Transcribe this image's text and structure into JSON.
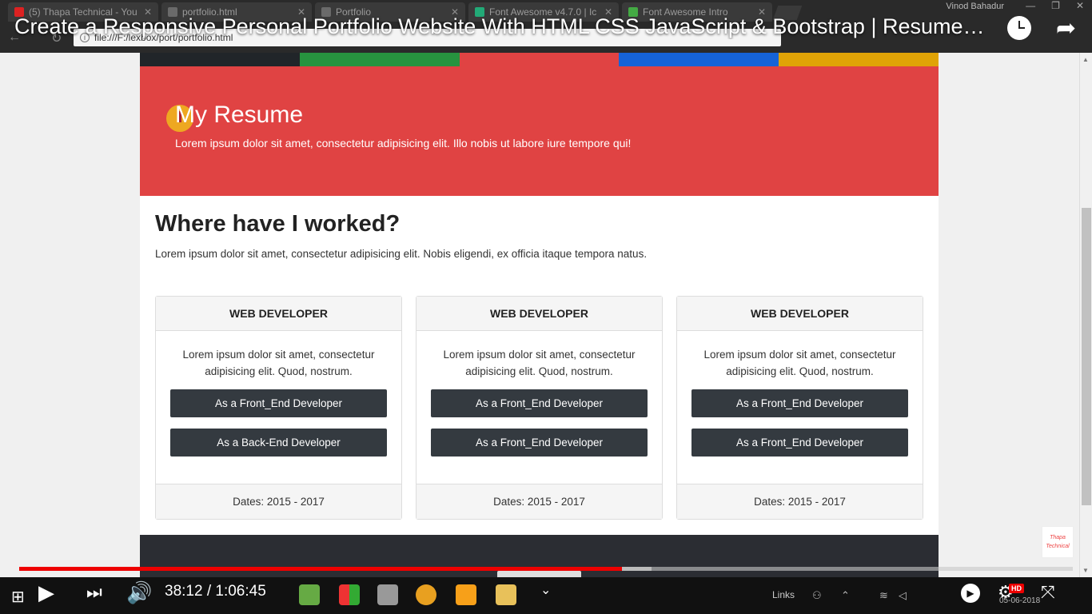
{
  "browser": {
    "tabs": [
      {
        "title": "(5) Thapa Technical - You"
      },
      {
        "title": "portfolio.html"
      },
      {
        "title": "Portfolio"
      },
      {
        "title": "Font Awesome v4.7.0 | Ic"
      },
      {
        "title": "Font Awesome Intro"
      }
    ],
    "user": "Vinod Bahadur",
    "url": "file:///F:/lexbox/port/portfolio.html"
  },
  "video": {
    "title": "Create a Responsive Personal Portfolio Website With HTML CSS JavaScript & Bootstrap | Resume Website",
    "current_time": "38:12",
    "duration": "1:06:45",
    "progress": 0.572,
    "hd_label": "HD"
  },
  "page": {
    "stripe_colors": [
      "#212529",
      "#27933f",
      "#e04343",
      "#1663d8",
      "#e0a306"
    ],
    "banner": {
      "title": "My Resume",
      "subtitle": "Lorem ipsum dolor sit amet, consectetur adipisicing elit. Illo nobis ut labore iure tempore qui!"
    },
    "worked": {
      "title": "Where have I worked?",
      "subtitle": "Lorem ipsum dolor sit amet, consectetur adipisicing elit. Nobis eligendi, ex officia itaque tempora natus."
    },
    "cards": [
      {
        "header": "WEB DEVELOPER",
        "text": "Lorem ipsum dolor sit amet, consectetur adipisicing elit. Quod, nostrum.",
        "button1": "As a Front_End Developer",
        "button2": "As a Back-End Developer",
        "footer": "Dates: 2015 - 2017"
      },
      {
        "header": "WEB DEVELOPER",
        "text": "Lorem ipsum dolor sit amet, consectetur adipisicing elit. Quod, nostrum.",
        "button1": "As a Front_End Developer",
        "button2": "As a Front_End Developer",
        "footer": "Dates: 2015 - 2017"
      },
      {
        "header": "WEB DEVELOPER",
        "text": "Lorem ipsum dolor sit amet, consectetur adipisicing elit. Quod, nostrum.",
        "button1": "As a Front_End Developer",
        "button2": "As a Front_End Developer",
        "footer": "Dates: 2015 - 2017"
      }
    ]
  },
  "taskbar": {
    "links_label": "Links",
    "date": "05-06-2018"
  },
  "watermark": "Thapa Technical"
}
